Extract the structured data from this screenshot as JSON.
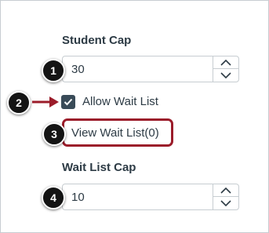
{
  "student_cap": {
    "label": "Student Cap",
    "value": "30"
  },
  "wait_list": {
    "checkbox_label": "Allow Wait List",
    "checked": true,
    "view_link": "View Wait List(0)"
  },
  "wait_list_cap": {
    "label": "Wait List Cap",
    "value": "10"
  },
  "callouts": [
    "1",
    "2",
    "3",
    "4"
  ],
  "colors": {
    "highlight": "#9b1c2a",
    "text": "#2d3b45",
    "checkbox": "#394b58",
    "border": "#c7cdd1",
    "callout": "#141414"
  },
  "icons": {
    "step_up": "chevron-up-icon",
    "step_down": "chevron-down-icon",
    "check": "checkmark-icon",
    "arrow": "arrow-right-icon"
  }
}
